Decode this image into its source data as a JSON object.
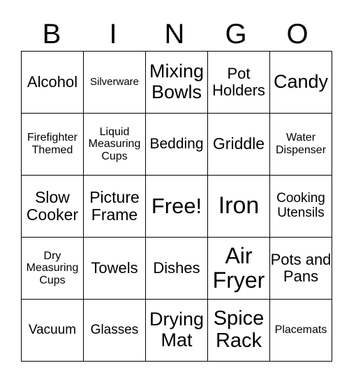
{
  "header": [
    "B",
    "I",
    "N",
    "G",
    "O"
  ],
  "cells": [
    [
      "Alcohol",
      "Silverware",
      "Mixing Bowls",
      "Pot Holders",
      "Candy"
    ],
    [
      "Firefighter Themed",
      "Liquid Measuring Cups",
      "Bedding",
      "Griddle",
      "Water Dispenser"
    ],
    [
      "Slow Cooker",
      "Picture Frame",
      "Free!",
      "Iron",
      "Cooking Utensils"
    ],
    [
      "Dry Measuring Cups",
      "Towels",
      "Dishes",
      "Air Fryer",
      "Pots and Pans"
    ],
    [
      "Vacuum",
      "Glasses",
      "Drying Mat",
      "Spice Rack",
      "Placemats"
    ]
  ]
}
